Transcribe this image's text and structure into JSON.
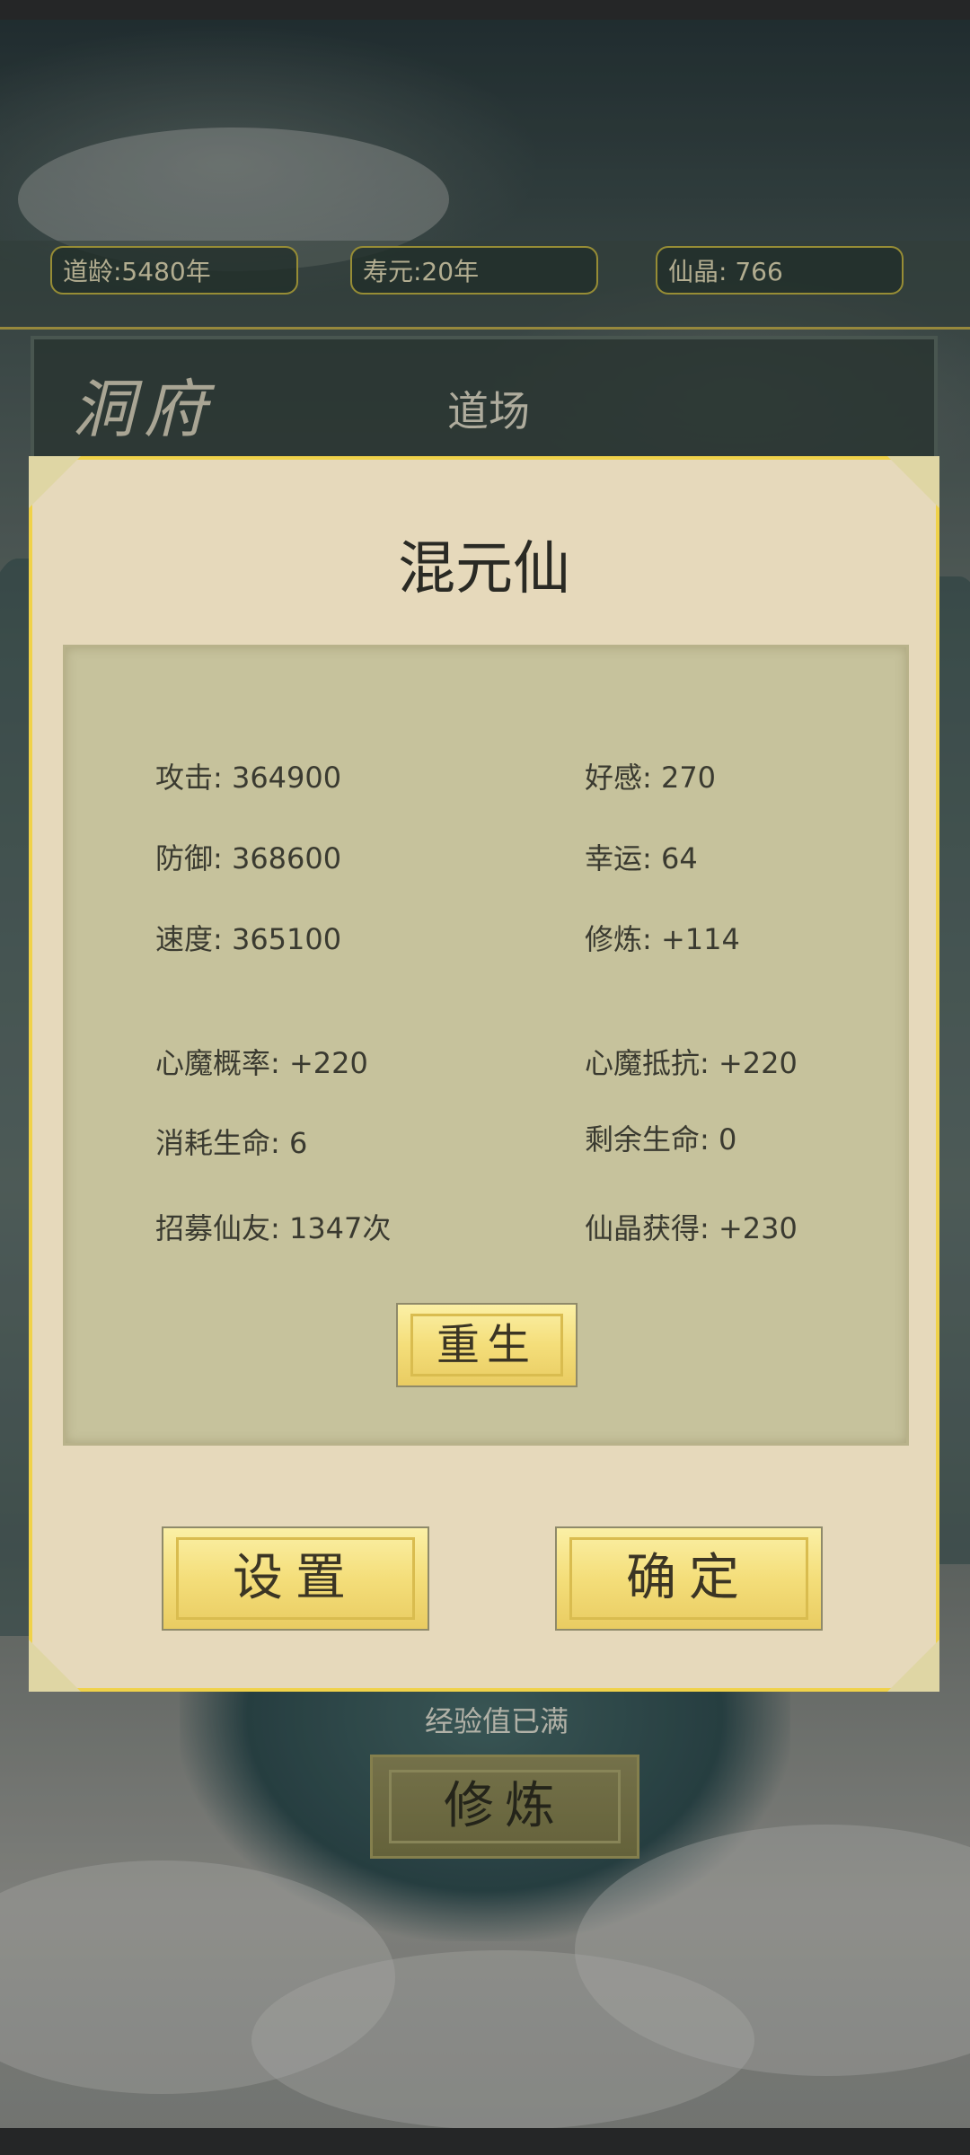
{
  "top_stats": {
    "age": "道龄:5480年",
    "lifespan": "寿元:20年",
    "crystals": "仙晶: 766"
  },
  "header": {
    "cave_title": "洞府",
    "tab_daochang": "道场"
  },
  "background": {
    "exp_status": "经验值已满",
    "cultivate_button": "修炼"
  },
  "dialog": {
    "title": "混元仙",
    "stats": {
      "attack": "攻击: 364900",
      "favor": "好感: 270",
      "defense": "防御: 368600",
      "luck": "幸运: 64",
      "speed": "速度: 365100",
      "cultivation": "修炼: +114",
      "demon_chance": "心魔概率: +220",
      "demon_resist": "心魔抵抗: +220",
      "life_consumed": "消耗生命: 6",
      "life_remaining": "剩余生命: 0",
      "recruit_count": "招募仙友: 1347次",
      "crystal_gain": "仙晶获得: +230"
    },
    "rebirth_button": "重生",
    "settings_button": "设置",
    "confirm_button": "确定"
  },
  "colors": {
    "dialog_bg": "#e6d9bb",
    "dialog_border": "#f0d24a",
    "panel_bg": "#c6c29c",
    "gold_button": "#f4de7a"
  }
}
